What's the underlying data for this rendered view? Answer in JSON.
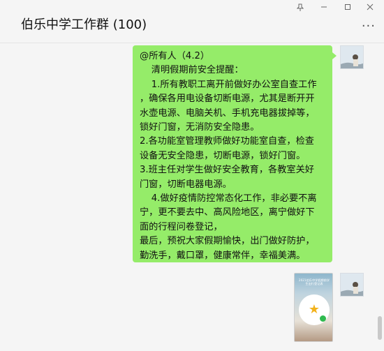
{
  "header": {
    "title": "伯乐中学工作群 (100)",
    "more_label": "..."
  },
  "window_controls": [
    {
      "name": "pin-icon",
      "glyph": "⊥"
    },
    {
      "name": "minimize-icon",
      "glyph": "—"
    },
    {
      "name": "maximize-icon",
      "glyph": "☐"
    },
    {
      "name": "close-icon",
      "glyph": "✕"
    }
  ],
  "messages": [
    {
      "type": "text",
      "text": "@所有人（4.2）\n    清明假期前安全提醒：\n    1.所有教职工离开前做好办公室自查工作\n，确保各用电设备切断电源，尤其是断开开\n水壶电源、电脑关机、手机充电器拔掉等，\n锁好门窗，无消防安全隐患。\n2.各功能室管理教师做好功能室自查，检查\n设备无安全隐患，切断电源，锁好门窗。\n3.班主任对学生做好安全教育，各教室关好\n门窗，切断电器电源。\n    4.做好疫情防控常态化工作，非必要不离\n宁，更不要去中、高风险地区，离宁做好下\n面的行程问卷登记，\n最后，预祝大家假期愉快，出门做好防护，\n勤洗手，戴口罩，健康常伴，幸福美满。"
    },
    {
      "type": "image",
      "caption": "2021伯乐中学假期前学生出行登记表"
    }
  ],
  "colors": {
    "bubble": "#95ec69",
    "background": "#f5f5f5"
  }
}
